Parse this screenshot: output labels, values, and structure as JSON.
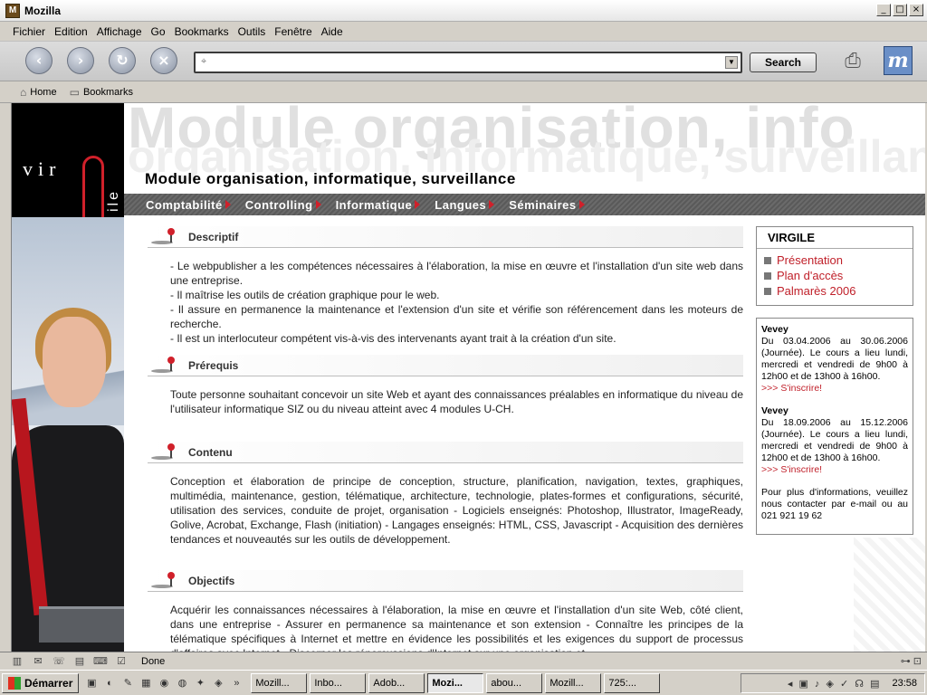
{
  "window": {
    "title": "Mozilla",
    "icon_text": "M",
    "min": "_",
    "max": "□",
    "close": "×"
  },
  "menu": [
    "Fichier",
    "Edition",
    "Affichage",
    "Go",
    "Bookmarks",
    "Outils",
    "Fenêtre",
    "Aide"
  ],
  "toolbar": {
    "back_icon": "‹",
    "forward_icon": "›",
    "reload_icon": "↻",
    "stop_icon": "×",
    "url_value": "",
    "url_icon": "⌖",
    "search_label": "Search",
    "print_icon": "⎙",
    "m_logo": "m"
  },
  "personal": {
    "home_icon": "⌂",
    "home_label": "Home",
    "bookmarks_icon": "▭",
    "bookmarks_label": "Bookmarks"
  },
  "site": {
    "brand_vir": "vir",
    "brand_ile": "ile",
    "bg_line1": "Module organisation, info",
    "bg_line2": "organisation, informatique, surveillance",
    "title": "Module organisation, informatique, surveillance",
    "nav": [
      "Comptabilité",
      "Controlling",
      "Informatique",
      "Langues",
      "Séminaires"
    ],
    "sections": [
      {
        "title": "Descriptif",
        "lines": [
          "- Le webpublisher a les compétences nécessaires à l'élaboration, la mise en œuvre et l'installation d'un site web dans une entreprise.",
          "- Il maîtrise les outils de création graphique pour le web.",
          "- Il assure en permanence la maintenance et l'extension d'un site et vérifie son référencement dans les moteurs de recherche.",
          "- Il est un interlocuteur compétent vis-à-vis des intervenants ayant trait à la création d'un site."
        ]
      },
      {
        "title": "Prérequis",
        "lines": [
          "Toute personne souhaitant concevoir un site Web et ayant des connaissances préalables en informatique du niveau de l'utilisateur informatique SIZ ou du niveau atteint avec 4 modules U-CH."
        ]
      },
      {
        "title": "Contenu",
        "lines": [
          "Conception et élaboration de principe de conception, structure, planification, navigation, textes, graphiques, multimédia, maintenance, gestion, télématique, architecture, technologie, plates-formes et configurations, sécurité, utilisation des services, conduite de projet, organisation - Logiciels enseignés: Photoshop, Illustrator, ImageReady, Golive, Acrobat, Exchange, Flash (initiation) - Langages enseignés: HTML, CSS, Javascript - Acquisition des dernières tendances et nouveautés sur les outils de développement."
        ]
      },
      {
        "title": "Objectifs",
        "lines": [
          "Acquérir les connaissances nécessaires à l'élaboration, la mise en œuvre et l'installation d'un site Web, côté client, dans une entreprise - Assurer en permanence sa maintenance et son extension - Connaître les principes de la télématique spécifiques à Internet et mettre en évidence les possibilités et les exigences du support de processus d'affaires avec Internet - Discerner les répercussions d'Internet sur une organisation et"
        ]
      }
    ],
    "sidebar": {
      "title": "VIRGILE",
      "items": [
        "Présentation",
        "Plan d'accès",
        "Palmarès 2006"
      ]
    },
    "info": {
      "sessions": [
        {
          "city": "Vevey",
          "text": "Du 03.04.2006 au 30.06.2006 (Journée). Le cours a lieu lundi, mercredi et vendredi de 9h00 à 12h00 et de 13h00 à 16h00.",
          "link": ">>> S'inscrire!"
        },
        {
          "city": "Vevey",
          "text": "Du 18.09.2006 au 15.12.2006 (Journée). Le cours a lieu lundi, mercredi et vendredi de 9h00 à 12h00 et de 13h00 à 16h00.",
          "link": ">>> S'inscrire!"
        }
      ],
      "contact": "Pour plus d'informations, veuillez nous contacter par e-mail ou au 021 921 19 62"
    }
  },
  "status": {
    "text": "Done",
    "icons": [
      "▥",
      "✉",
      "☏",
      "▤",
      "⌨",
      "☑"
    ],
    "right": "⊶ ⊡"
  },
  "taskbar": {
    "start_label": "Démarrer",
    "quicklaunch": [
      "▣",
      "◐",
      "✎",
      "▦",
      "◉",
      "◍",
      "✦",
      "◈",
      "»"
    ],
    "tasks": [
      "Mozill...",
      "Inbo...",
      "Adob...",
      "Mozi...",
      "abou...",
      "Mozill...",
      "725:..."
    ],
    "active_task": 3,
    "tray": "◂ ▣ ♪ ◈ ✓ ☊ ▤",
    "clock": "23:58"
  }
}
